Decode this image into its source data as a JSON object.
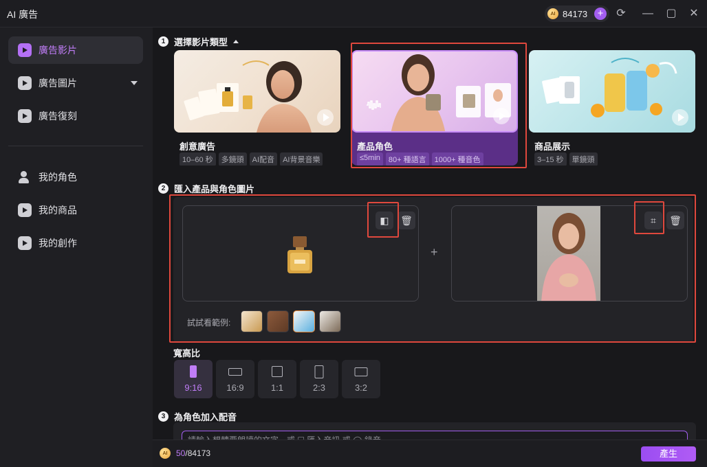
{
  "app": {
    "title": "AI 廣告"
  },
  "header": {
    "credits": "84173",
    "add_credits": "+"
  },
  "sidebar": {
    "items": [
      {
        "label": "廣告影片"
      },
      {
        "label": "廣告圖片"
      },
      {
        "label": "廣告復刻"
      },
      {
        "label": "我的角色"
      },
      {
        "label": "我的商品"
      },
      {
        "label": "我的創作"
      }
    ]
  },
  "step1": {
    "number": "1",
    "title": "選擇影片類型",
    "cards": [
      {
        "title": "創意廣告",
        "tags": [
          "10–60 秒",
          "多鏡頭",
          "AI配音",
          "AI背景音樂"
        ]
      },
      {
        "title": "產品角色",
        "tags": [
          "≤5min",
          "80+ 種語言",
          "1000+ 種音色"
        ]
      },
      {
        "title": "商品展示",
        "tags": [
          "3–15 秒",
          "單鏡頭"
        ]
      }
    ]
  },
  "step2": {
    "number": "2",
    "title": "匯入產品與角色圖片",
    "plus": "+",
    "examples_label": "試試看範例:"
  },
  "aspect": {
    "label": "寬高比",
    "options": [
      "9:16",
      "16:9",
      "1:1",
      "2:3",
      "3:2"
    ],
    "selected": "9:16"
  },
  "step3": {
    "number": "3",
    "title": "為角色加入配音",
    "placeholder": "請輸入想轉要朗讀的文字，或 ☐ 匯入音訊 或 ◯ 錄音"
  },
  "footer": {
    "used": "50",
    "total": "/84173",
    "generate_label": "產生"
  },
  "colors": {
    "accent": "#a35ef0",
    "highlight": "#e0483d"
  },
  "icons": [
    "play-icon",
    "remove-background-icon",
    "delete-icon",
    "crop-icon",
    "refresh-icon",
    "minimize-icon",
    "maximize-icon",
    "close-icon"
  ]
}
